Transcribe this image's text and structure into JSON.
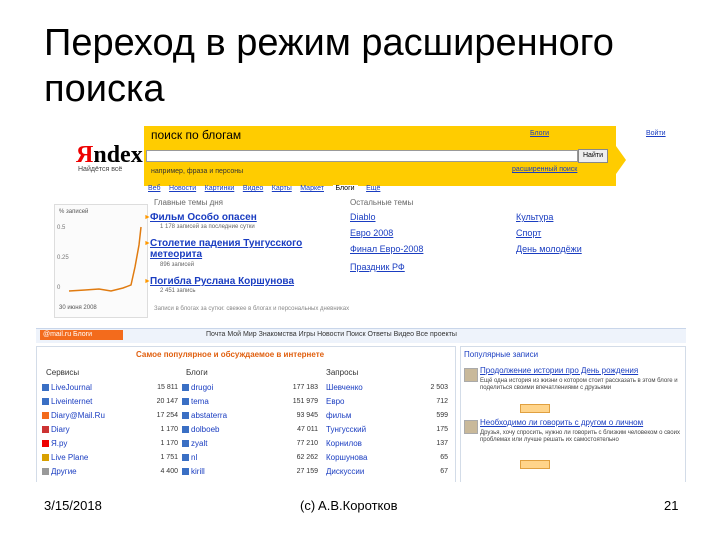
{
  "slide": {
    "title": "Переход в режим расширенного поиска",
    "footer_date": "3/15/2018",
    "footer_author": "(c) A.B.Коротков",
    "footer_page": "21"
  },
  "yandex": {
    "logo_y": "Я",
    "logo_rest": "ndex",
    "logo_sub": "Найдётся всё",
    "search_title": "поиск по блогам",
    "top_link_1": "Блоги",
    "top_link_2": "Войти",
    "search_button": "Найти",
    "hint": "например, фраза и персоны",
    "advanced_link": "расширенный поиск",
    "tabs": [
      "Веб",
      "Новости",
      "Картинки",
      "Видео",
      "Карты",
      "Маркет",
      "Блоги",
      "Ещё"
    ],
    "chart_caption": "% записей",
    "chart_ticks": [
      "0.5",
      "0.25",
      "0"
    ],
    "chart_footer": "30 июня 2008",
    "col_main": "Главные темы дня",
    "col_other": "Остальные темы",
    "stories": [
      {
        "title": "Фильм Особо опасен",
        "meta": "1 178 записей за последние сутки"
      },
      {
        "title": "Столетие падения Тунгусского метеорита",
        "meta": "896 записей"
      },
      {
        "title": "Погибла Руслана Коршунова",
        "meta": "2 451 запись"
      }
    ],
    "other_1": [
      "Diablo",
      "Евро 2008",
      "Финал Евро-2008",
      "Праздник РФ"
    ],
    "other_2": [
      "Культура",
      "Спорт",
      "День молодёжи"
    ],
    "note": "Записи в блогах за сутки: свежее в блогах и персональных дневниках"
  },
  "mail": {
    "strip_logo": "@mail.ru Блоги",
    "strip_nav": "Почта   Мой Мир   Знакомства   Игры   Новости   Поиск   Ответы   Видео   Все проекты",
    "panel_head": "Самое популярное и обсуждаемое в интернете",
    "sect_services": "Сервисы",
    "sect_blogs": "Блоги",
    "sect_queries": "Запросы",
    "services": [
      {
        "name": "LiveJournal",
        "count": "15 811"
      },
      {
        "name": "Liveinternet",
        "count": "20 147"
      },
      {
        "name": "Diary@Mail.Ru",
        "count": "17 254"
      },
      {
        "name": "Diary",
        "count": "1 170"
      },
      {
        "name": "Я.ру",
        "count": "1 170"
      },
      {
        "name": "Live Plane",
        "count": "1 751"
      },
      {
        "name": "Другие",
        "count": "4 400"
      }
    ],
    "blogs": [
      {
        "name": "drugoi",
        "count": "177 183"
      },
      {
        "name": "tema",
        "count": "151 979"
      },
      {
        "name": "abstaterra",
        "count": "93 945"
      },
      {
        "name": "dolboeb",
        "count": "47 011"
      },
      {
        "name": "zyalt",
        "count": "77 210"
      },
      {
        "name": "nl",
        "count": "62 262"
      },
      {
        "name": "kirill",
        "count": "27 159"
      }
    ],
    "queries": [
      {
        "name": "Шевченко",
        "count": "2 503"
      },
      {
        "name": "Евро",
        "count": "712"
      },
      {
        "name": "фильм",
        "count": "599"
      },
      {
        "name": "Тунгусский",
        "count": "175"
      },
      {
        "name": "Корнилов",
        "count": "137"
      },
      {
        "name": "Коршунова",
        "count": "65"
      },
      {
        "name": "Дискуссии",
        "count": "67"
      }
    ],
    "right_head": "Популярные записи",
    "posts": [
      {
        "title": "Продолжение истории про День рождения",
        "text": "Ещё одна история из жизни о котором стоит рассказать в этом блоге и поделиться своими впечатлениями с друзьями"
      },
      {
        "title": "Необходимо ли говорить с другом о личном",
        "text": "Друзья, хочу спросить, нужно ли говорить с близким человеком о своих проблемах или лучше решать их самостоятельно"
      }
    ]
  }
}
